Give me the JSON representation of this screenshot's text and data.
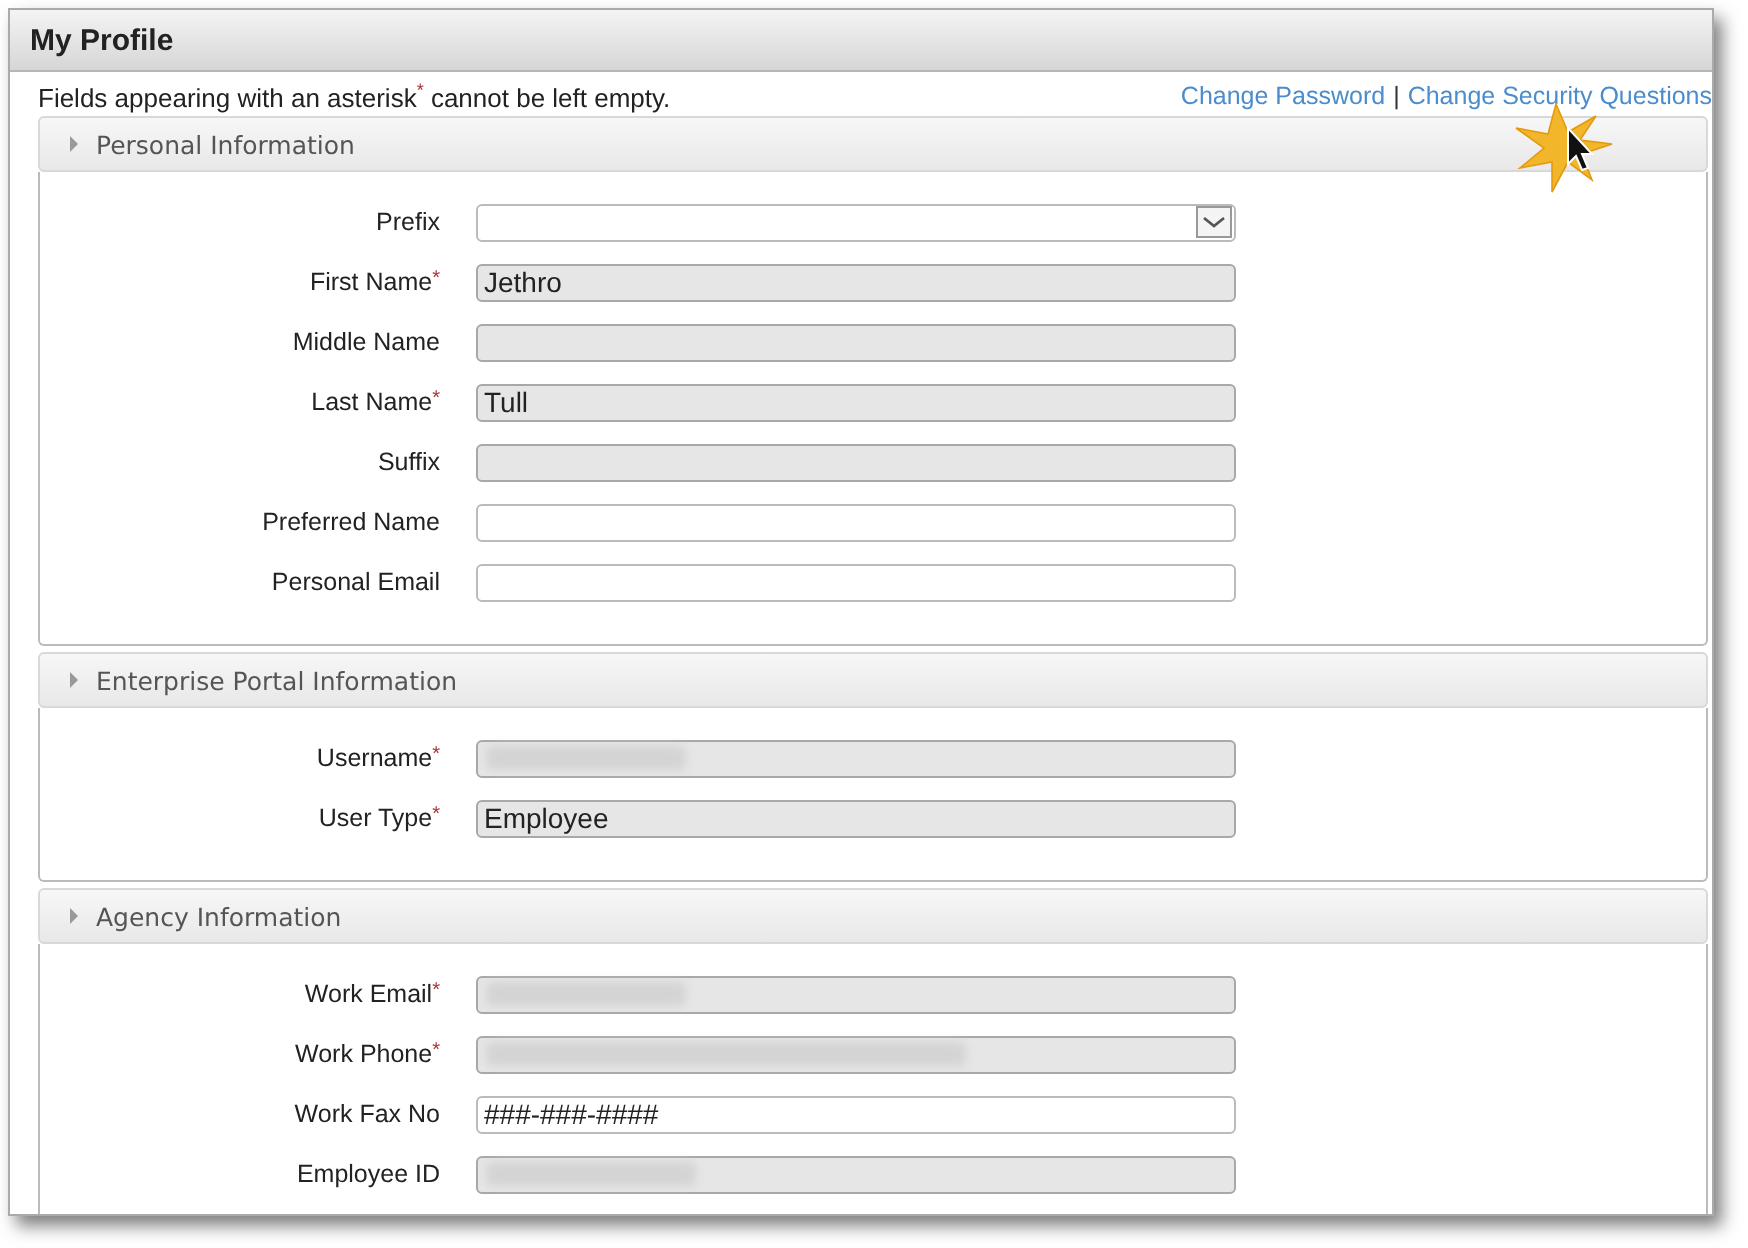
{
  "window": {
    "title": "My Profile"
  },
  "note": "Fields appearing with an asterisk$^{*}$ cannot be left empty.",
  "links": [
    "Change Password",
    "Change Security Questions"
  ],
  "link_separator": "|",
  "sections": [
    {
      "title": "Personal Information",
      "expanded": true,
      "fields": [
        {
          "label": "Prefix",
          "kind": "select",
          "disabled": false
        },
        {
          "label": "First Name",
          "asterisk": "*",
          "kind": "text",
          "disabled": true,
          "value": "Jethro"
        },
        {
          "label": "Middle Name",
          "kind": "text",
          "disabled": true
        },
        {
          "label": "Last Name",
          "asterisk": "*",
          "kind": "text",
          "disabled": true,
          "value": "Tull"
        },
        {
          "label": "Suffix",
          "kind": "text",
          "disabled": true
        },
        {
          "label": "Preferred Name",
          "kind": "text",
          "disabled": false
        },
        {
          "label": "Personal Email",
          "kind": "text",
          "disabled": false
        }
      ]
    },
    {
      "title": "Enterprise Portal Information",
      "expanded": true,
      "fields": [
        {
          "label": "Username",
          "asterisk": "*",
          "kind": "redacted",
          "disabled": true
        },
        {
          "label": "User Type",
          "asterisk": "*",
          "kind": "text",
          "disabled": true,
          "value": "Employee"
        }
      ]
    },
    {
      "title": "Agency Information",
      "expanded": true,
      "fields": [
        {
          "label": "Work Email",
          "asterisk": "*",
          "kind": "redacted",
          "disabled": true
        },
        {
          "label": "Work Phone",
          "asterisk": "*",
          "kind": "redacted",
          "disabled": true
        },
        {
          "label": "Work Fax No",
          "kind": "text",
          "disabled": false,
          "value": "###-###-####"
        },
        {
          "label": "Employee ID",
          "kind": "redacted",
          "disabled": true
        }
      ]
    }
  ]
}
